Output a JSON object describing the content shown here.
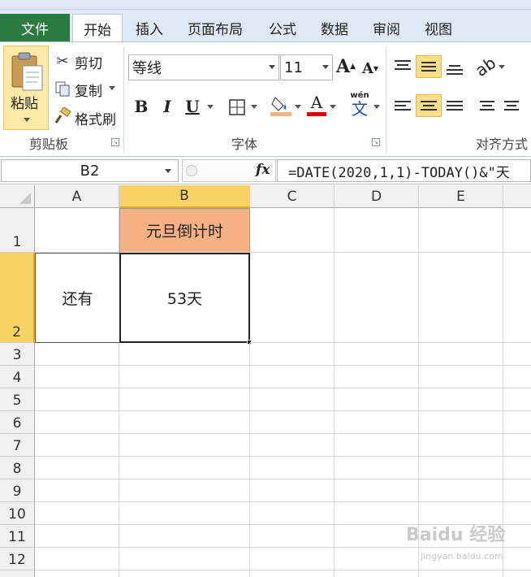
{
  "ribbon": {
    "tabs": [
      "文件",
      "开始",
      "插入",
      "页面布局",
      "公式",
      "数据",
      "审阅",
      "视图"
    ],
    "active_tab": "开始",
    "clipboard": {
      "paste": "粘贴",
      "cut": "剪切",
      "copy": "复制",
      "format_painter": "格式刷",
      "group_label": "剪贴板"
    },
    "font": {
      "font_name": "等线",
      "font_size": "11",
      "bold": "B",
      "italic": "I",
      "underline": "U",
      "font_color_letter": "A",
      "phonetic": "wén",
      "phonetic_char": "文",
      "group_label": "字体",
      "fill_color": "#f4b183",
      "font_color": "#e00000"
    },
    "alignment": {
      "group_label": "对齐方式"
    }
  },
  "formula_bar": {
    "name_box": "B2",
    "fx": "fx",
    "formula": "=DATE(2020,1,1)-TODAY()&\"天"
  },
  "sheet": {
    "columns": [
      "A",
      "B",
      "C",
      "D",
      "E"
    ],
    "selected_column": "B",
    "rows": [
      "1",
      "2",
      "3",
      "4",
      "5",
      "6",
      "7",
      "8",
      "9",
      "10",
      "11",
      "12"
    ],
    "selected_row": "2",
    "cells": {
      "B1": "元旦倒计时",
      "A2": "还有",
      "B2": "53天"
    },
    "b1_fill": "#f4b183",
    "selection_color": "#f8d364"
  },
  "watermark": {
    "text": "Baidu 经验",
    "sub": "jingyan.baidu.com"
  }
}
